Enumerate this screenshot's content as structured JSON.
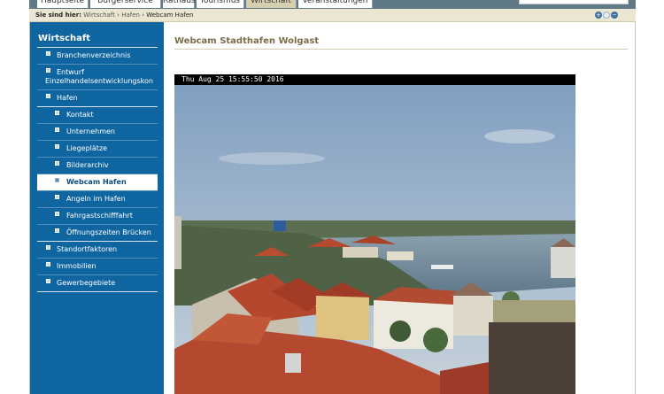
{
  "topnav": {
    "tabs": [
      {
        "label": "Hauptseite",
        "active": false
      },
      {
        "label": "Bürgerservice",
        "active": false
      },
      {
        "label": "Rathaus",
        "active": false
      },
      {
        "label": "Tourismus",
        "active": false
      },
      {
        "label": "Wirtschaft",
        "active": true
      },
      {
        "label": "Veranstaltungen",
        "active": false
      }
    ]
  },
  "breadcrumb": {
    "prefix": "Sie sind hier:",
    "items": [
      "Wirtschaft",
      "Hafen",
      "Webcam Hafen"
    ],
    "separator": "›"
  },
  "zoom": {
    "plus": "+",
    "minus": "−"
  },
  "sidebar": {
    "title": "Wirtschaft",
    "items": [
      {
        "label": "Branchenverzeichnis"
      },
      {
        "label_1": "Entwurf",
        "label_2": "Einzelhandelsentwicklungskon"
      },
      {
        "label": "Hafen"
      },
      {
        "label": "Kontakt"
      },
      {
        "label": "Unternehmen"
      },
      {
        "label": "Liegeplätze"
      },
      {
        "label": "Bilderarchiv"
      },
      {
        "label": "Webcam Hafen"
      },
      {
        "label": "Angeln im Hafen"
      },
      {
        "label": "Fahrgastschifffahrt"
      },
      {
        "label": "Öffnungszeiten Brücken"
      },
      {
        "label": "Standortfaktoren"
      },
      {
        "label": "Immobilien"
      },
      {
        "label": "Gewerbegebiete"
      }
    ]
  },
  "main": {
    "title": "Webcam Stadthafen Wolgast",
    "webcam_timestamp": "Thu Aug 25  15:55:50  2016"
  },
  "colors": {
    "sidebar": "#0f659f",
    "topbar": "#5f7a86",
    "breadcrumb_bar": "#ebe6d1",
    "title": "#7c6d4a"
  }
}
